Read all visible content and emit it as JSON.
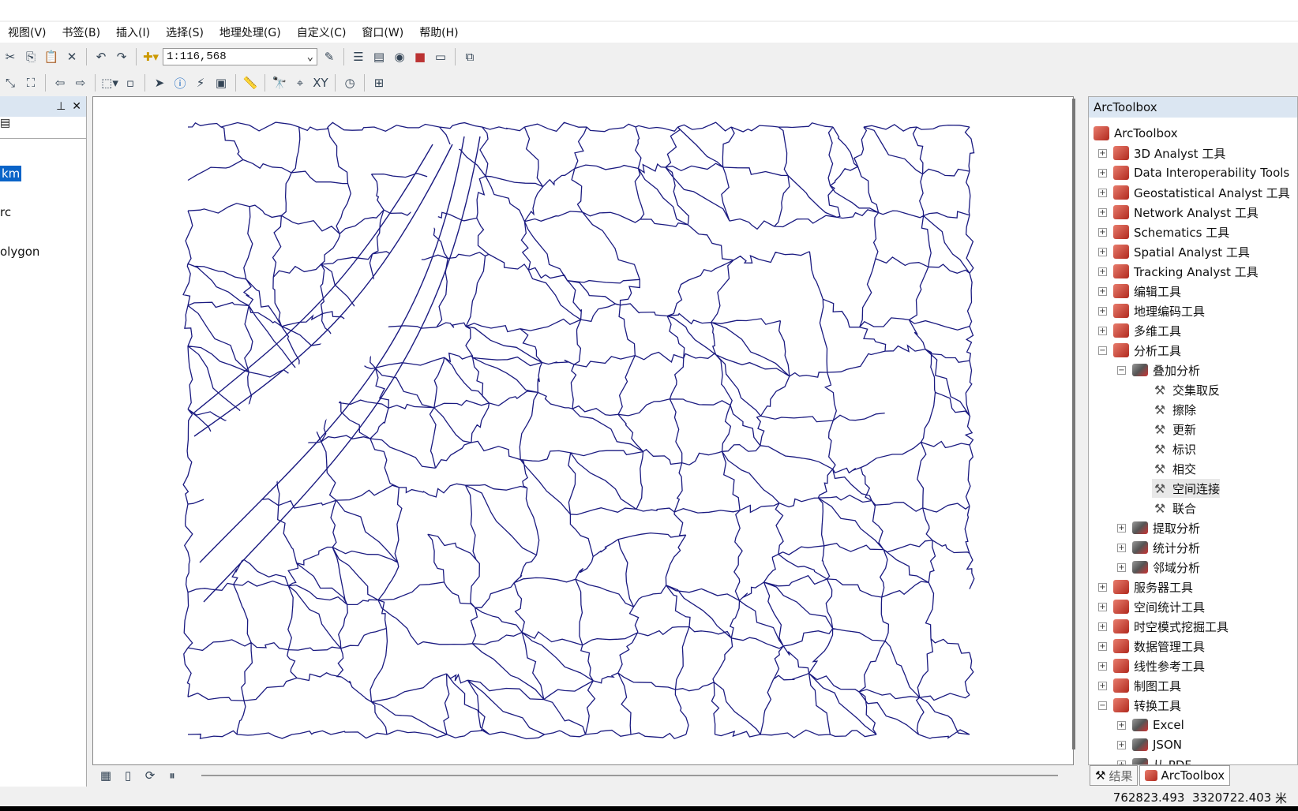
{
  "menus": [
    "视图(V)",
    "书签(B)",
    "插入(I)",
    "选择(S)",
    "地理处理(G)",
    "自定义(C)",
    "窗口(W)",
    "帮助(H)"
  ],
  "toolbar": {
    "scale": "1:116,568"
  },
  "toc": {
    "layers": [
      "km",
      "rc",
      "olygon"
    ]
  },
  "toolbox": {
    "title": "ArcToolbox",
    "nodes": [
      {
        "label": "ArcToolbox",
        "level": 0,
        "type": "root",
        "exp": ""
      },
      {
        "label": "3D Analyst 工具",
        "level": 1,
        "type": "box",
        "exp": "+"
      },
      {
        "label": "Data Interoperability Tools",
        "level": 1,
        "type": "box",
        "exp": "+"
      },
      {
        "label": "Geostatistical Analyst 工具",
        "level": 1,
        "type": "box",
        "exp": "+"
      },
      {
        "label": "Network Analyst 工具",
        "level": 1,
        "type": "box",
        "exp": "+"
      },
      {
        "label": "Schematics 工具",
        "level": 1,
        "type": "box",
        "exp": "+"
      },
      {
        "label": "Spatial Analyst 工具",
        "level": 1,
        "type": "box",
        "exp": "+"
      },
      {
        "label": "Tracking Analyst 工具",
        "level": 1,
        "type": "box",
        "exp": "+"
      },
      {
        "label": "编辑工具",
        "level": 1,
        "type": "box",
        "exp": "+"
      },
      {
        "label": "地理编码工具",
        "level": 1,
        "type": "box",
        "exp": "+"
      },
      {
        "label": "多维工具",
        "level": 1,
        "type": "box",
        "exp": "+"
      },
      {
        "label": "分析工具",
        "level": 1,
        "type": "box",
        "exp": "-"
      },
      {
        "label": "叠加分析",
        "level": 2,
        "type": "set",
        "exp": "-"
      },
      {
        "label": "交集取反",
        "level": 3,
        "type": "tool",
        "exp": ""
      },
      {
        "label": "擦除",
        "level": 3,
        "type": "tool",
        "exp": ""
      },
      {
        "label": "更新",
        "level": 3,
        "type": "tool",
        "exp": ""
      },
      {
        "label": "标识",
        "level": 3,
        "type": "tool",
        "exp": ""
      },
      {
        "label": "相交",
        "level": 3,
        "type": "tool",
        "exp": ""
      },
      {
        "label": "空间连接",
        "level": 3,
        "type": "tool",
        "exp": "",
        "hover": true
      },
      {
        "label": "联合",
        "level": 3,
        "type": "tool",
        "exp": ""
      },
      {
        "label": "提取分析",
        "level": 2,
        "type": "set",
        "exp": "+"
      },
      {
        "label": "统计分析",
        "level": 2,
        "type": "set",
        "exp": "+"
      },
      {
        "label": "邻域分析",
        "level": 2,
        "type": "set",
        "exp": "+"
      },
      {
        "label": "服务器工具",
        "level": 1,
        "type": "box",
        "exp": "+"
      },
      {
        "label": "空间统计工具",
        "level": 1,
        "type": "box",
        "exp": "+"
      },
      {
        "label": "时空模式挖掘工具",
        "level": 1,
        "type": "box",
        "exp": "+"
      },
      {
        "label": "数据管理工具",
        "level": 1,
        "type": "box",
        "exp": "+"
      },
      {
        "label": "线性参考工具",
        "level": 1,
        "type": "box",
        "exp": "+"
      },
      {
        "label": "制图工具",
        "level": 1,
        "type": "box",
        "exp": "+"
      },
      {
        "label": "转换工具",
        "level": 1,
        "type": "box",
        "exp": "-"
      },
      {
        "label": "Excel",
        "level": 2,
        "type": "set",
        "exp": "+"
      },
      {
        "label": "JSON",
        "level": 2,
        "type": "set",
        "exp": "+"
      },
      {
        "label": "从 PDF",
        "level": 2,
        "type": "set",
        "exp": "+"
      }
    ]
  },
  "tabs": [
    "结果",
    "ArcToolbox"
  ],
  "status": {
    "x": "762823.493",
    "y": "3320722.403",
    "unit": "米"
  },
  "colors": {
    "map_lines": "#1a1a80",
    "selection": "#0a64c8"
  }
}
